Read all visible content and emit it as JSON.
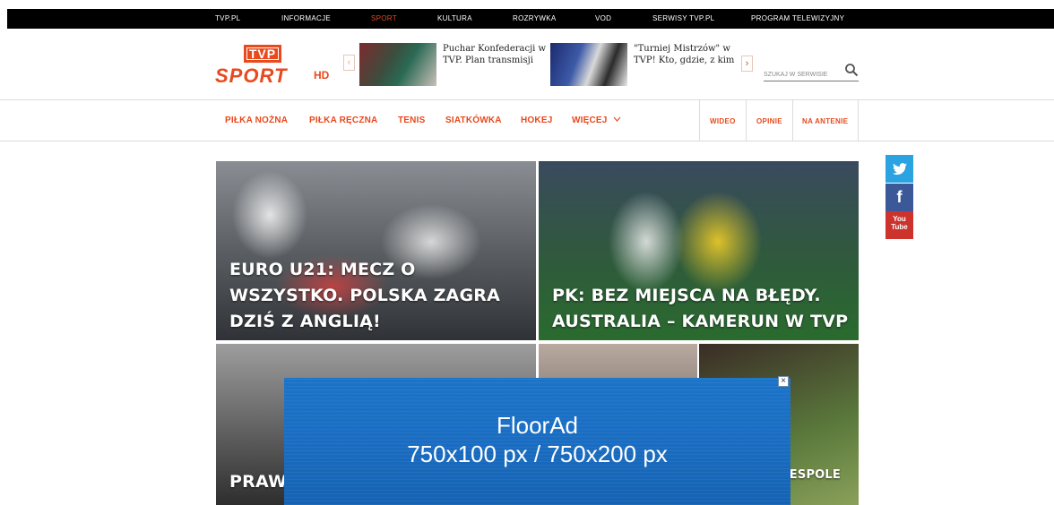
{
  "topnav": [
    "TVP.PL",
    "INFORMACJE",
    "SPORT",
    "KULTURA",
    "ROZRYWKA",
    "VOD",
    "SERWISY TVP.PL",
    "PROGRAM TELEWIZYJNY"
  ],
  "logo": {
    "box": "TVP",
    "sport": "SPORT",
    "hd": "HD"
  },
  "promos": [
    "Puchar Konfederacji w TVP. Plan transmisji",
    "\"Turniej Mistrzów\" w TVP! Kto, gdzie, z kim"
  ],
  "search": {
    "placeholder": "SZUKAJ W SERWISIE"
  },
  "catnav": [
    "PIŁKA NOŻNA",
    "PIŁKA RĘCZNA",
    "TENIS",
    "SIATKÓWKA",
    "HOKEJ",
    "WIĘCEJ"
  ],
  "rightnav": [
    "WIDEO",
    "OPINIE",
    "NA ANTENIE"
  ],
  "social": {
    "facebook": "f",
    "youtube_top": "You",
    "youtube_bottom": "Tube"
  },
  "tiles": [
    "EURO U21: MECZ O WSZYSTKO. POLSKA ZAGRA DZIŚ Z ANGLIĄ!",
    "PK: BEZ MIEJSCA NA BŁĘDY. AUSTRALIA – KAMERUN W TVP",
    "PRAW ALIM",
    "",
    "KI: CHCĘ ESPOLE"
  ],
  "floorad": {
    "line1": "FloorAd",
    "line2": "750x100 px / 750x200 px"
  },
  "colors": {
    "accent": "#e8491d",
    "topbar": "#000000",
    "ad_blue": "#1a6dc2"
  }
}
